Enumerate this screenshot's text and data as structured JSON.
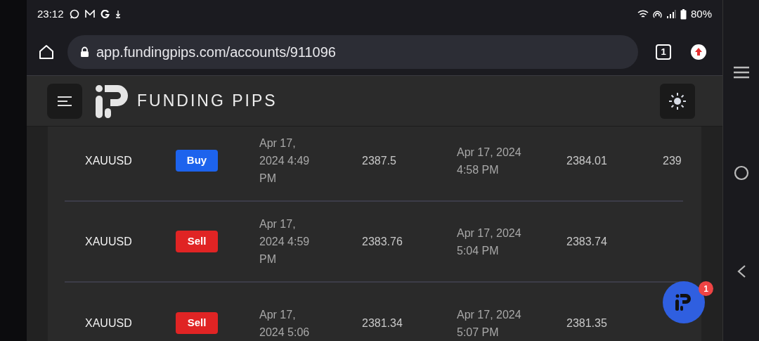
{
  "status_bar": {
    "time": "23:12",
    "battery": "80%"
  },
  "browser": {
    "url": "app.fundingpips.com/accounts/911096",
    "tab_count": "1"
  },
  "header": {
    "brand": "FUNDING PIPS"
  },
  "table": {
    "rows": [
      {
        "column_1": "XAUUSD",
        "column_2": {
          "label": "Buy",
          "kind": "buy"
        },
        "column_3": "Apr 17, 2024 4:49 PM",
        "column_4": "2387.5",
        "column_5": "Apr 17, 2024 4:58 PM",
        "column_6": "2384.01",
        "column_7": "239"
      },
      {
        "column_1": "XAUUSD",
        "column_2": {
          "label": "Sell",
          "kind": "sell"
        },
        "column_3": "Apr 17, 2024 4:59 PM",
        "column_4": "2383.76",
        "column_5": "Apr 17, 2024 5:04 PM",
        "column_6": "2383.74"
      },
      {
        "column_1": "XAUUSD",
        "column_2": {
          "label": "Sell",
          "kind": "sell"
        },
        "column_3": "Apr 17, 2024 5:06",
        "column_4": "2381.34",
        "column_5": "Apr 17, 2024 5:07 PM",
        "column_6": "2381.35"
      }
    ]
  },
  "chat": {
    "badge": "1"
  }
}
